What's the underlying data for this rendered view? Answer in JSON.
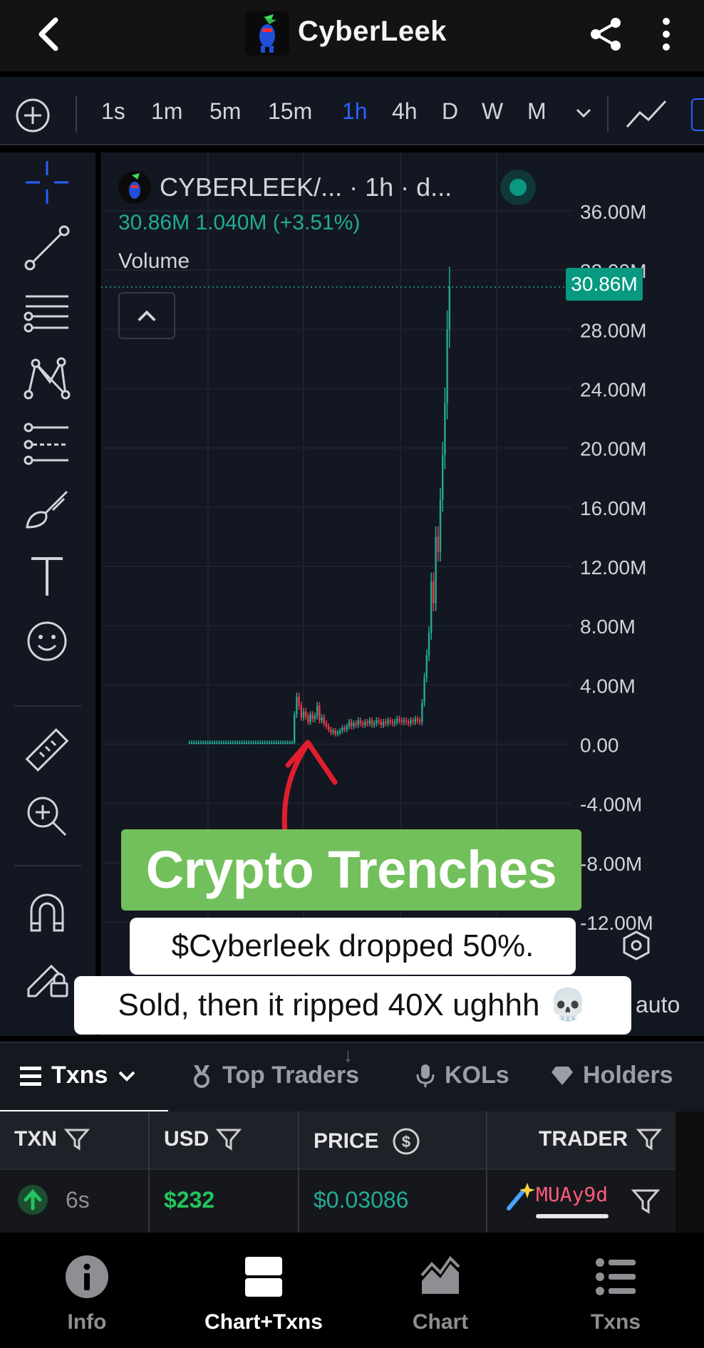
{
  "header": {
    "title": "CyberLeek"
  },
  "timeframes": {
    "items": [
      "1s",
      "1m",
      "5m",
      "15m",
      "1h",
      "4h",
      "D",
      "W",
      "M"
    ],
    "active": "1h"
  },
  "chart": {
    "symbol": "CYBERLEEK/... · 1h · d...",
    "ohlc_line": "30.86M  1.040M (+3.51%)",
    "volume_label": "Volume",
    "current_price_tag": "30.86M",
    "scale_mode": "auto",
    "accent_up": "#22ab94",
    "accent_down": "#f23645"
  },
  "chart_data": {
    "type": "candlestick",
    "ylim": [
      -12000000,
      36000000
    ],
    "y_ticks": [
      "36.00M",
      "32.00M",
      "28.00M",
      "24.00M",
      "20.00M",
      "16.00M",
      "12.00M",
      "8.00M",
      "4.00M",
      "0.00",
      "-4.00M",
      "-8.00M",
      "-12.00M"
    ],
    "y_tick_values": [
      36000000,
      32000000,
      28000000,
      24000000,
      20000000,
      16000000,
      12000000,
      8000000,
      4000000,
      0,
      -4000000,
      -8000000,
      -12000000
    ],
    "last_price": 30860000,
    "approx_close_series_M": [
      0.1,
      0.1,
      0.1,
      0.1,
      0.1,
      0.1,
      0.1,
      0.1,
      0.1,
      0.1,
      0.1,
      0.1,
      0.1,
      0.1,
      0.1,
      0.1,
      0.1,
      0.1,
      0.1,
      0.1,
      0.1,
      0.1,
      0.1,
      0.1,
      0.1,
      0.1,
      0.1,
      0.1,
      0.1,
      0.1,
      0.1,
      0.1,
      0.1,
      0.1,
      0.1,
      0.1,
      0.1,
      0.1,
      0.1,
      0.1,
      0.1,
      0.1,
      0.1,
      0.1,
      0.1,
      0.1,
      2.0,
      3.2,
      2.6,
      1.8,
      2.2,
      1.9,
      1.5,
      2.0,
      1.7,
      1.9,
      2.6,
      1.6,
      1.8,
      1.4,
      1.2,
      1.0,
      0.8,
      0.9,
      0.7,
      0.8,
      0.9,
      1.1,
      1.0,
      1.2,
      1.5,
      1.2,
      1.4,
      1.3,
      1.6,
      1.4,
      1.3,
      1.5,
      1.4,
      1.6,
      1.3,
      1.4,
      1.6,
      1.5,
      1.3,
      1.5,
      1.4,
      1.6,
      1.5,
      1.4,
      1.5,
      1.7,
      1.6,
      1.5,
      1.6,
      1.5,
      1.4,
      1.6,
      1.5,
      1.7,
      1.6,
      1.5,
      2.8,
      4.5,
      6.0,
      7.5,
      11.0,
      9.5,
      14.0,
      13.0,
      16.5,
      19.5,
      23.0,
      28.0,
      30.86
    ]
  },
  "overlay": {
    "banner": "Crypto Trenches",
    "caption_line1": "$Cyberleek dropped 50%.",
    "caption_line2": "Sold, then it ripped 40X ughhh 💀"
  },
  "tabs": [
    {
      "label": "Txns"
    },
    {
      "label": "Top Traders"
    },
    {
      "label": "KOLs"
    },
    {
      "label": "Holders"
    }
  ],
  "table": {
    "headers": [
      "TXN",
      "USD",
      "PRICE",
      "TRADER"
    ],
    "row": {
      "age": "6s",
      "usd": "$232",
      "price": "$0.03086",
      "trader": "MUAy9d"
    }
  },
  "bottom_nav": [
    "Info",
    "Chart+Txns",
    "Chart",
    "Txns"
  ]
}
